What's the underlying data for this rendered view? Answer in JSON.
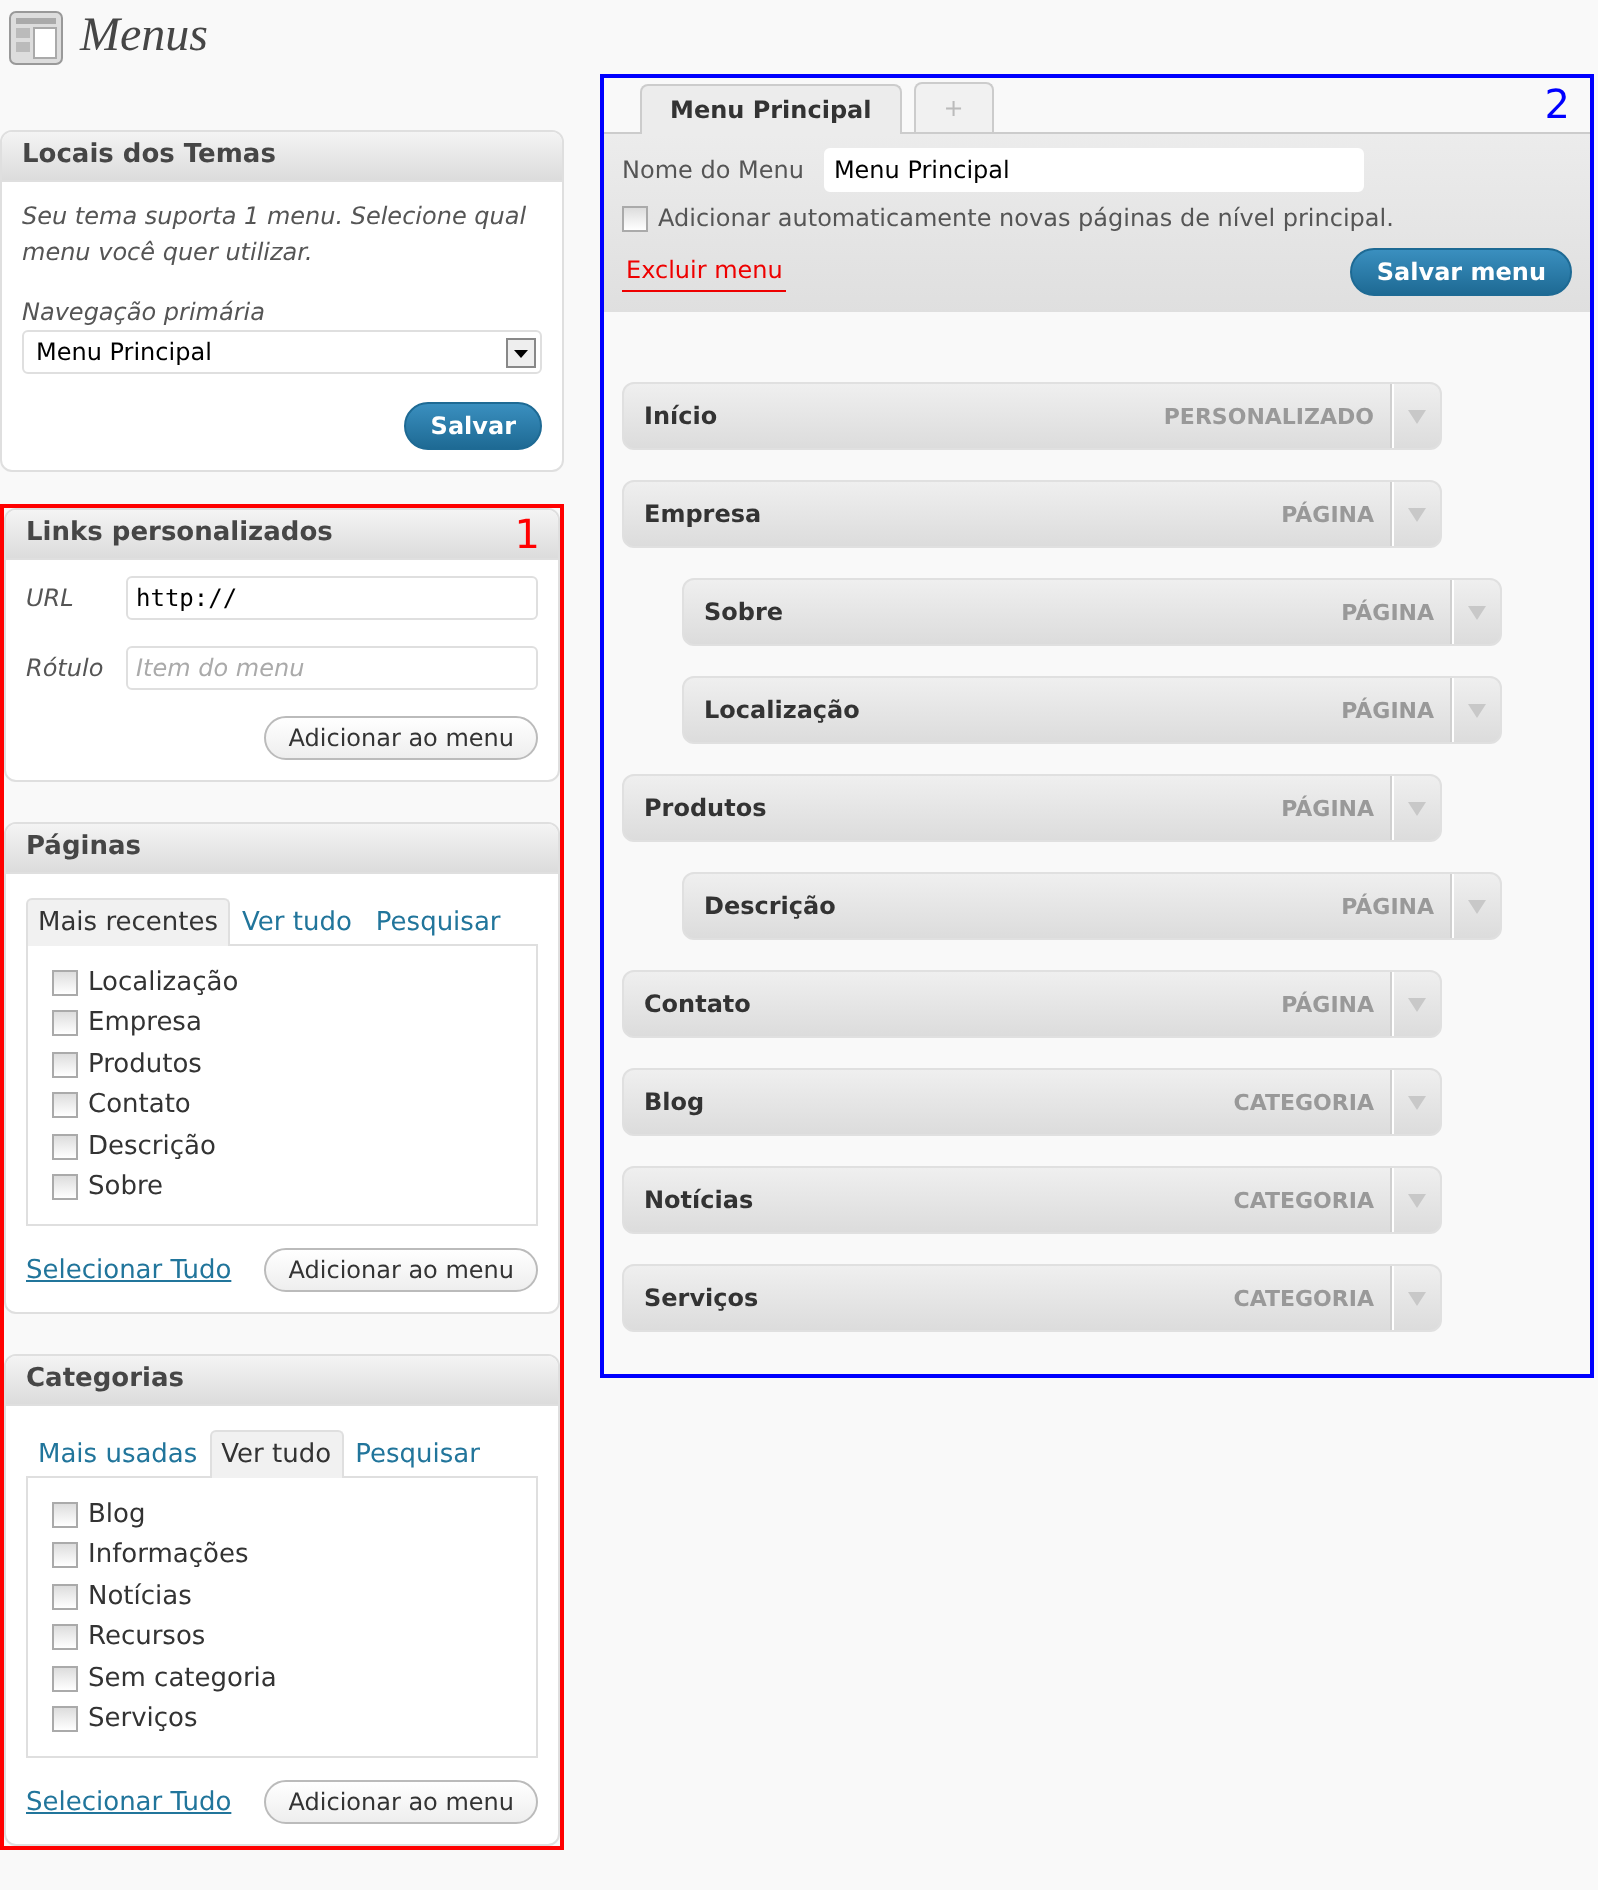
{
  "page": {
    "title": "Menus"
  },
  "annotations": [
    {
      "label": "1",
      "color": "#ff0000"
    },
    {
      "label": "2",
      "color": "#0000ff"
    }
  ],
  "theme_locations": {
    "title": "Locais dos Temas",
    "description": "Seu tema suporta 1 menu. Selecione qual menu você quer utilizar.",
    "location_label": "Navegação primária",
    "location_value": "Menu Principal",
    "save_button": "Salvar"
  },
  "custom_links": {
    "title": "Links personalizados",
    "url_label": "URL",
    "url_value": "http://",
    "label_label": "Rótulo",
    "label_placeholder": "Item do menu",
    "add_button": "Adicionar ao menu"
  },
  "pages": {
    "title": "Páginas",
    "tabs": [
      {
        "label": "Mais recentes",
        "selected": true
      },
      {
        "label": "Ver tudo",
        "selected": false
      },
      {
        "label": "Pesquisar",
        "selected": false
      }
    ],
    "items": [
      {
        "label": "Localização",
        "checked": false
      },
      {
        "label": "Empresa",
        "checked": false
      },
      {
        "label": "Produtos",
        "checked": false
      },
      {
        "label": "Contato",
        "checked": false
      },
      {
        "label": "Descrição",
        "checked": false
      },
      {
        "label": "Sobre",
        "checked": false
      }
    ],
    "select_all": "Selecionar Tudo",
    "add_button": "Adicionar ao menu"
  },
  "categories": {
    "title": "Categorias",
    "tabs": [
      {
        "label": "Mais usadas",
        "selected": false
      },
      {
        "label": "Ver tudo",
        "selected": true
      },
      {
        "label": "Pesquisar",
        "selected": false
      }
    ],
    "items": [
      {
        "label": "Blog",
        "checked": false
      },
      {
        "label": "Informações",
        "checked": false
      },
      {
        "label": "Notícias",
        "checked": false
      },
      {
        "label": "Recursos",
        "checked": false
      },
      {
        "label": "Sem categoria",
        "checked": false
      },
      {
        "label": "Serviços",
        "checked": false
      }
    ],
    "select_all": "Selecionar Tudo",
    "add_button": "Adicionar ao menu"
  },
  "menu_editor": {
    "tabs": [
      {
        "label": "Menu Principal",
        "selected": true
      },
      {
        "label": "+",
        "selected": false
      }
    ],
    "name_label": "Nome do Menu",
    "name_value": "Menu Principal",
    "auto_add": {
      "label": "Adicionar automaticamente novas páginas de nível principal.",
      "checked": false
    },
    "delete_link": "Excluir menu",
    "save_button": "Salvar menu",
    "items": [
      {
        "title": "Início",
        "type": "PERSONALIZADO"
      },
      {
        "title": "Empresa",
        "type": "PÁGINA",
        "children": [
          {
            "title": "Sobre",
            "type": "PÁGINA"
          },
          {
            "title": "Localização",
            "type": "PÁGINA"
          }
        ]
      },
      {
        "title": "Produtos",
        "type": "PÁGINA",
        "children": [
          {
            "title": "Descrição",
            "type": "PÁGINA"
          }
        ]
      },
      {
        "title": "Contato",
        "type": "PÁGINA"
      },
      {
        "title": "Blog",
        "type": "CATEGORIA"
      },
      {
        "title": "Notícias",
        "type": "CATEGORIA"
      },
      {
        "title": "Serviços",
        "type": "CATEGORIA"
      }
    ]
  }
}
